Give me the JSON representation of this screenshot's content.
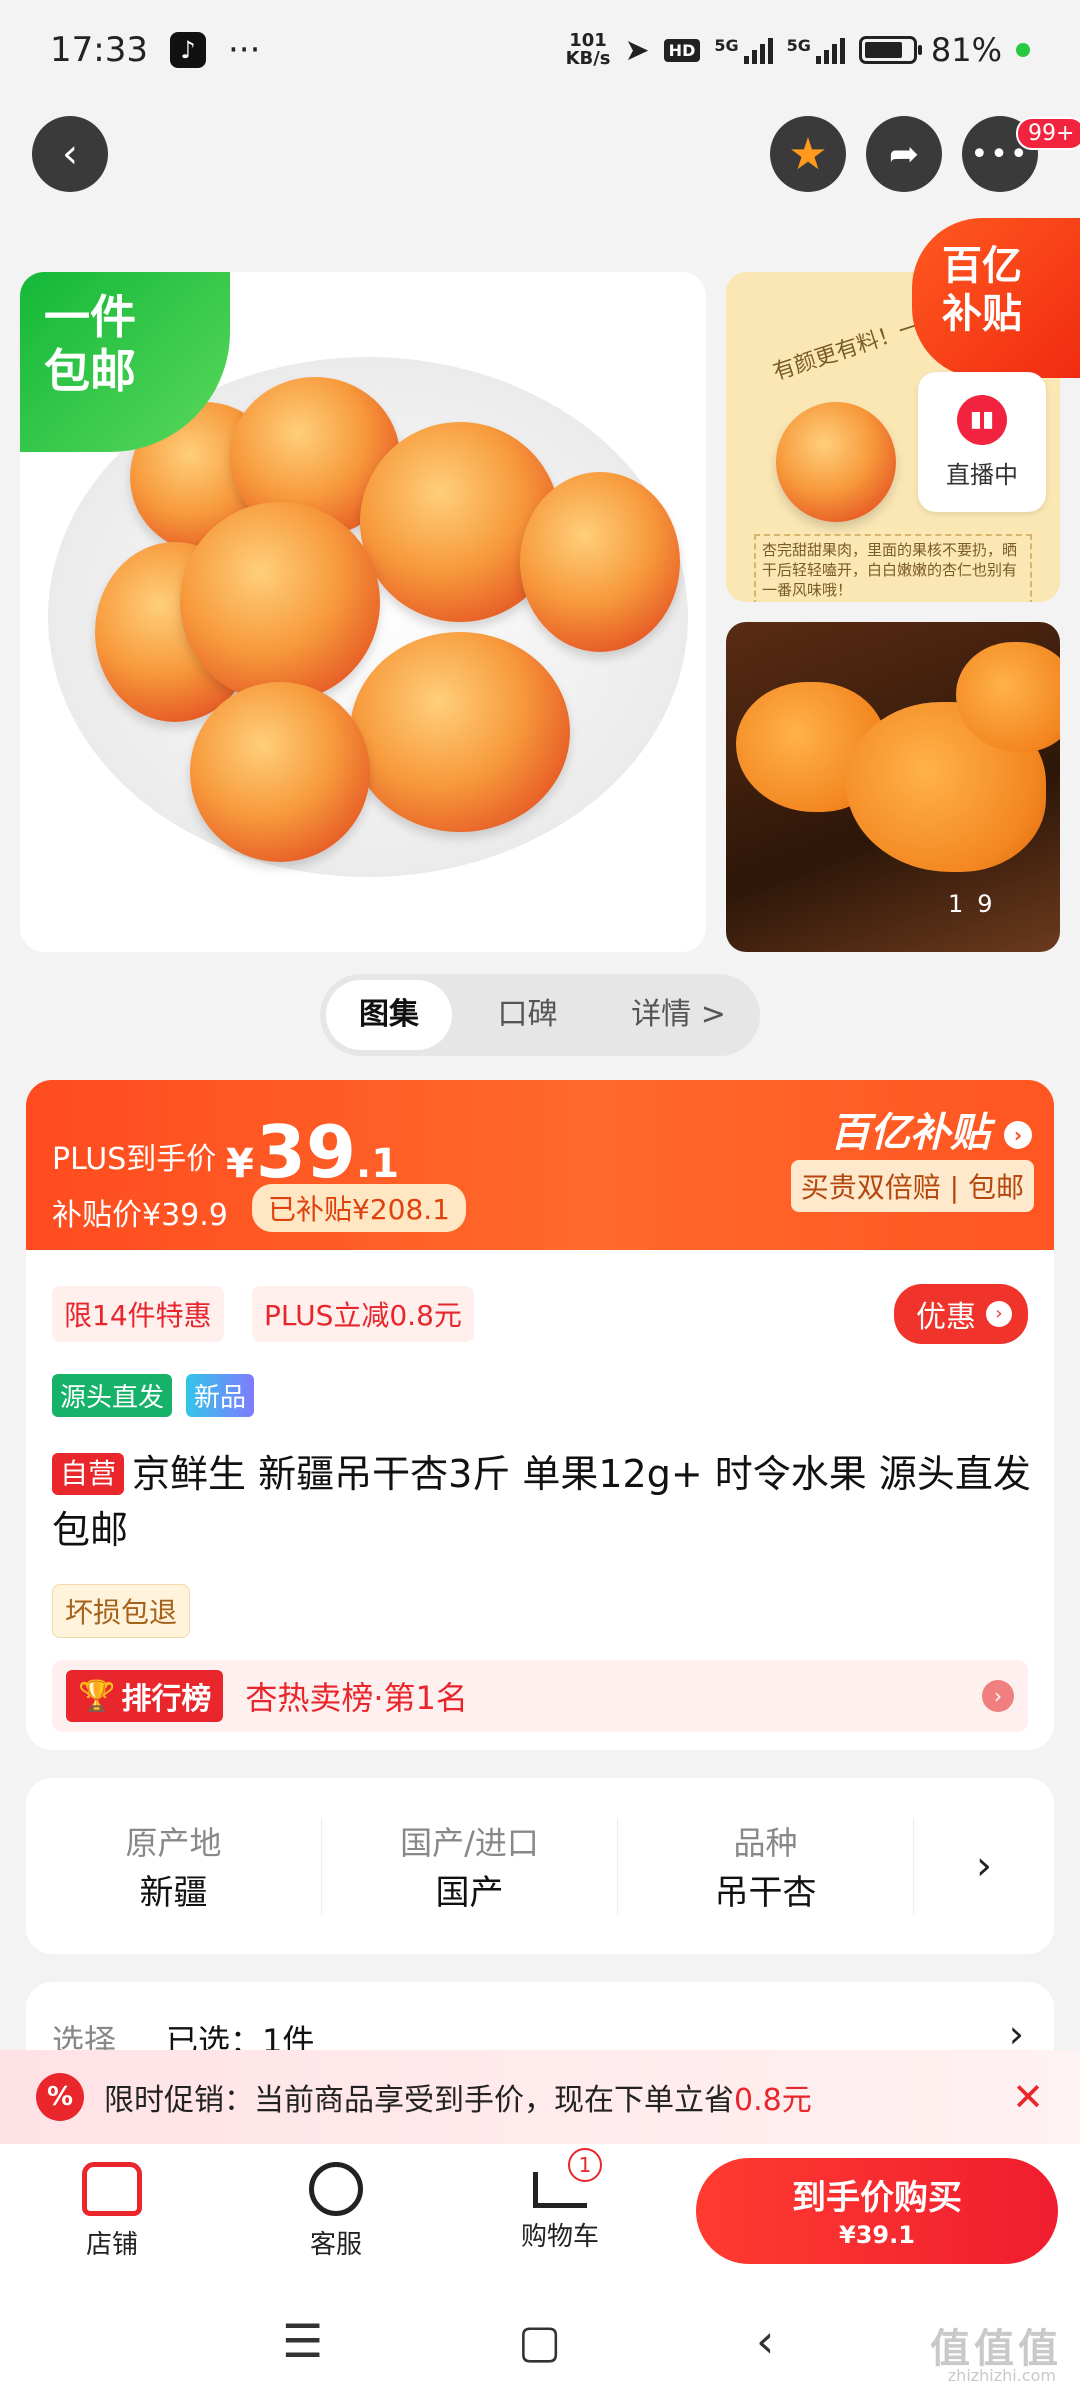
{
  "status_bar": {
    "time": "17:33",
    "dots": "···",
    "net_speed_value": "101",
    "net_speed_unit": "KB/s",
    "hd": "HD",
    "net1": "5G",
    "net2": "5G",
    "battery": "81%"
  },
  "top_actions": {
    "back_icon": "back-arrow-icon",
    "star_icon": "star-icon",
    "share_icon": "share-icon",
    "more_icon": "more-icon",
    "badge": "99+"
  },
  "gallery": {
    "main_badge": "一件包邮",
    "subsidy_badge_line1": "百亿",
    "subsidy_badge_line2": "补贴",
    "side1_text": "有颜更有料！一果两吃·小彩蛋",
    "side1_note": "杏完甜甜果肉，里面的果核不要扔，晒干后轻轻嗑开，白白嫩嫩的杏仁也别有一番风味哦！",
    "live_label": "直播中",
    "counter_current": "1",
    "counter_total": "9"
  },
  "tabs": [
    {
      "label": "图集"
    },
    {
      "label": "口碑"
    },
    {
      "label": "详情 >"
    }
  ],
  "price_card": {
    "plus_label": "PLUS到手价",
    "yen": "¥",
    "price_int": "39",
    "price_dec": ".1",
    "subsidy_price": "补贴价¥39.9",
    "subsidy_tag": "已补贴¥208.1",
    "logo": "百亿补贴",
    "guarantee": "买贵双倍赔 | 包邮"
  },
  "product": {
    "chip_limit": "限14件特惠",
    "chip_plus": "PLUS立减0.8元",
    "coupon": "优惠",
    "tag_source": "源头直发",
    "tag_new": "新品",
    "self_tag": "自营",
    "title": "京鲜生 新疆吊干杏3斤 单果12g+  时令水果 源头直发包邮",
    "damage": "坏损包退",
    "rank_badge": "排行榜",
    "rank_text": "杏热卖榜·第1名"
  },
  "attributes": [
    {
      "key": "原产地",
      "value": "新疆"
    },
    {
      "key": "国产/进口",
      "value": "国产"
    },
    {
      "key": "品种",
      "value": "吊干杏"
    }
  ],
  "select_row": {
    "label": "选择",
    "value": "已选：1件"
  },
  "promo": {
    "text": "限时促销：当前商品享受到手价，现在下单立省",
    "amount": "0.8元"
  },
  "bottom_bar": {
    "shop": "店铺",
    "service": "客服",
    "cart": "购物车",
    "cart_count": "1",
    "buy_main": "到手价购买",
    "buy_sub": "¥39.1"
  },
  "watermark": {
    "main": "值值值",
    "sub": "zhizhizhi.com"
  },
  "colors": {
    "accent_red": "#e8262b",
    "price_orange": "#ff4b1f",
    "free_ship_green": "#13b838"
  }
}
